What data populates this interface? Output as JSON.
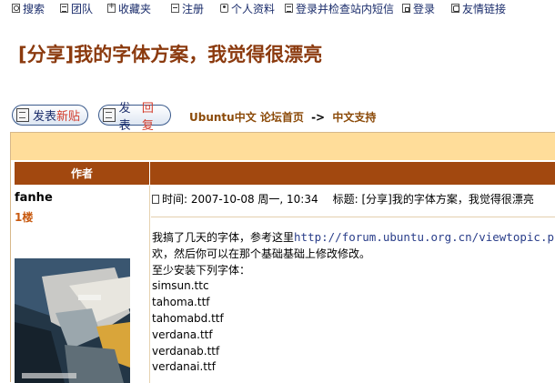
{
  "topnav": [
    {
      "label": "搜索",
      "icon": "search-icon"
    },
    {
      "label": "团队",
      "icon": "list-icon"
    },
    {
      "label": "收藏夹",
      "icon": "plus-icon"
    },
    {
      "label": "注册",
      "icon": "edit-icon"
    },
    {
      "label": "个人资料",
      "icon": "person-icon"
    },
    {
      "label": "登录并检查站内短信",
      "icon": "message-icon"
    },
    {
      "label": "登录",
      "icon": "lock-icon"
    },
    {
      "label": "友情链接",
      "icon": "chat-icon"
    }
  ],
  "page_title": "[分享]我的字体方案，我觉得很漂亮",
  "buttons": {
    "new_topic": {
      "prefix": "发表",
      "accent": "新贴",
      "icon": "post-icon"
    },
    "reply": {
      "prefix": "发表",
      "accent": "回复",
      "icon": "reply-icon"
    }
  },
  "breadcrumb": {
    "home": "Ubuntu中文 论坛首页",
    "separator": "->",
    "current": "中文支持"
  },
  "table": {
    "author_header": "作者"
  },
  "post": {
    "author": "fanhe",
    "floor": "1楼",
    "time": "时间: 2007-10-08 周一, 10:34",
    "subject": "标题: [分享]我的字体方案，我觉得很漂亮",
    "line1_text": "我搞了几天的字体，参考这里",
    "line1_link": "http://forum.ubuntu.org.cn/viewtopic.php?",
    "line2": "欢，然后你可以在那个基础基础上修改修改。",
    "line3": "至少安装下列字体：",
    "fonts": [
      "simsun.ttc",
      "tahoma.ttf",
      "tahomabd.ttf",
      "verdana.ttf",
      "verdanab.ttf",
      "verdanai.ttf"
    ]
  },
  "colors": {
    "accent": "#8b3a0e",
    "header_band": "#ffdd9a",
    "column_header": "#a2480f",
    "link": "#2a3e8a",
    "button_accent": "#d23a2a"
  }
}
